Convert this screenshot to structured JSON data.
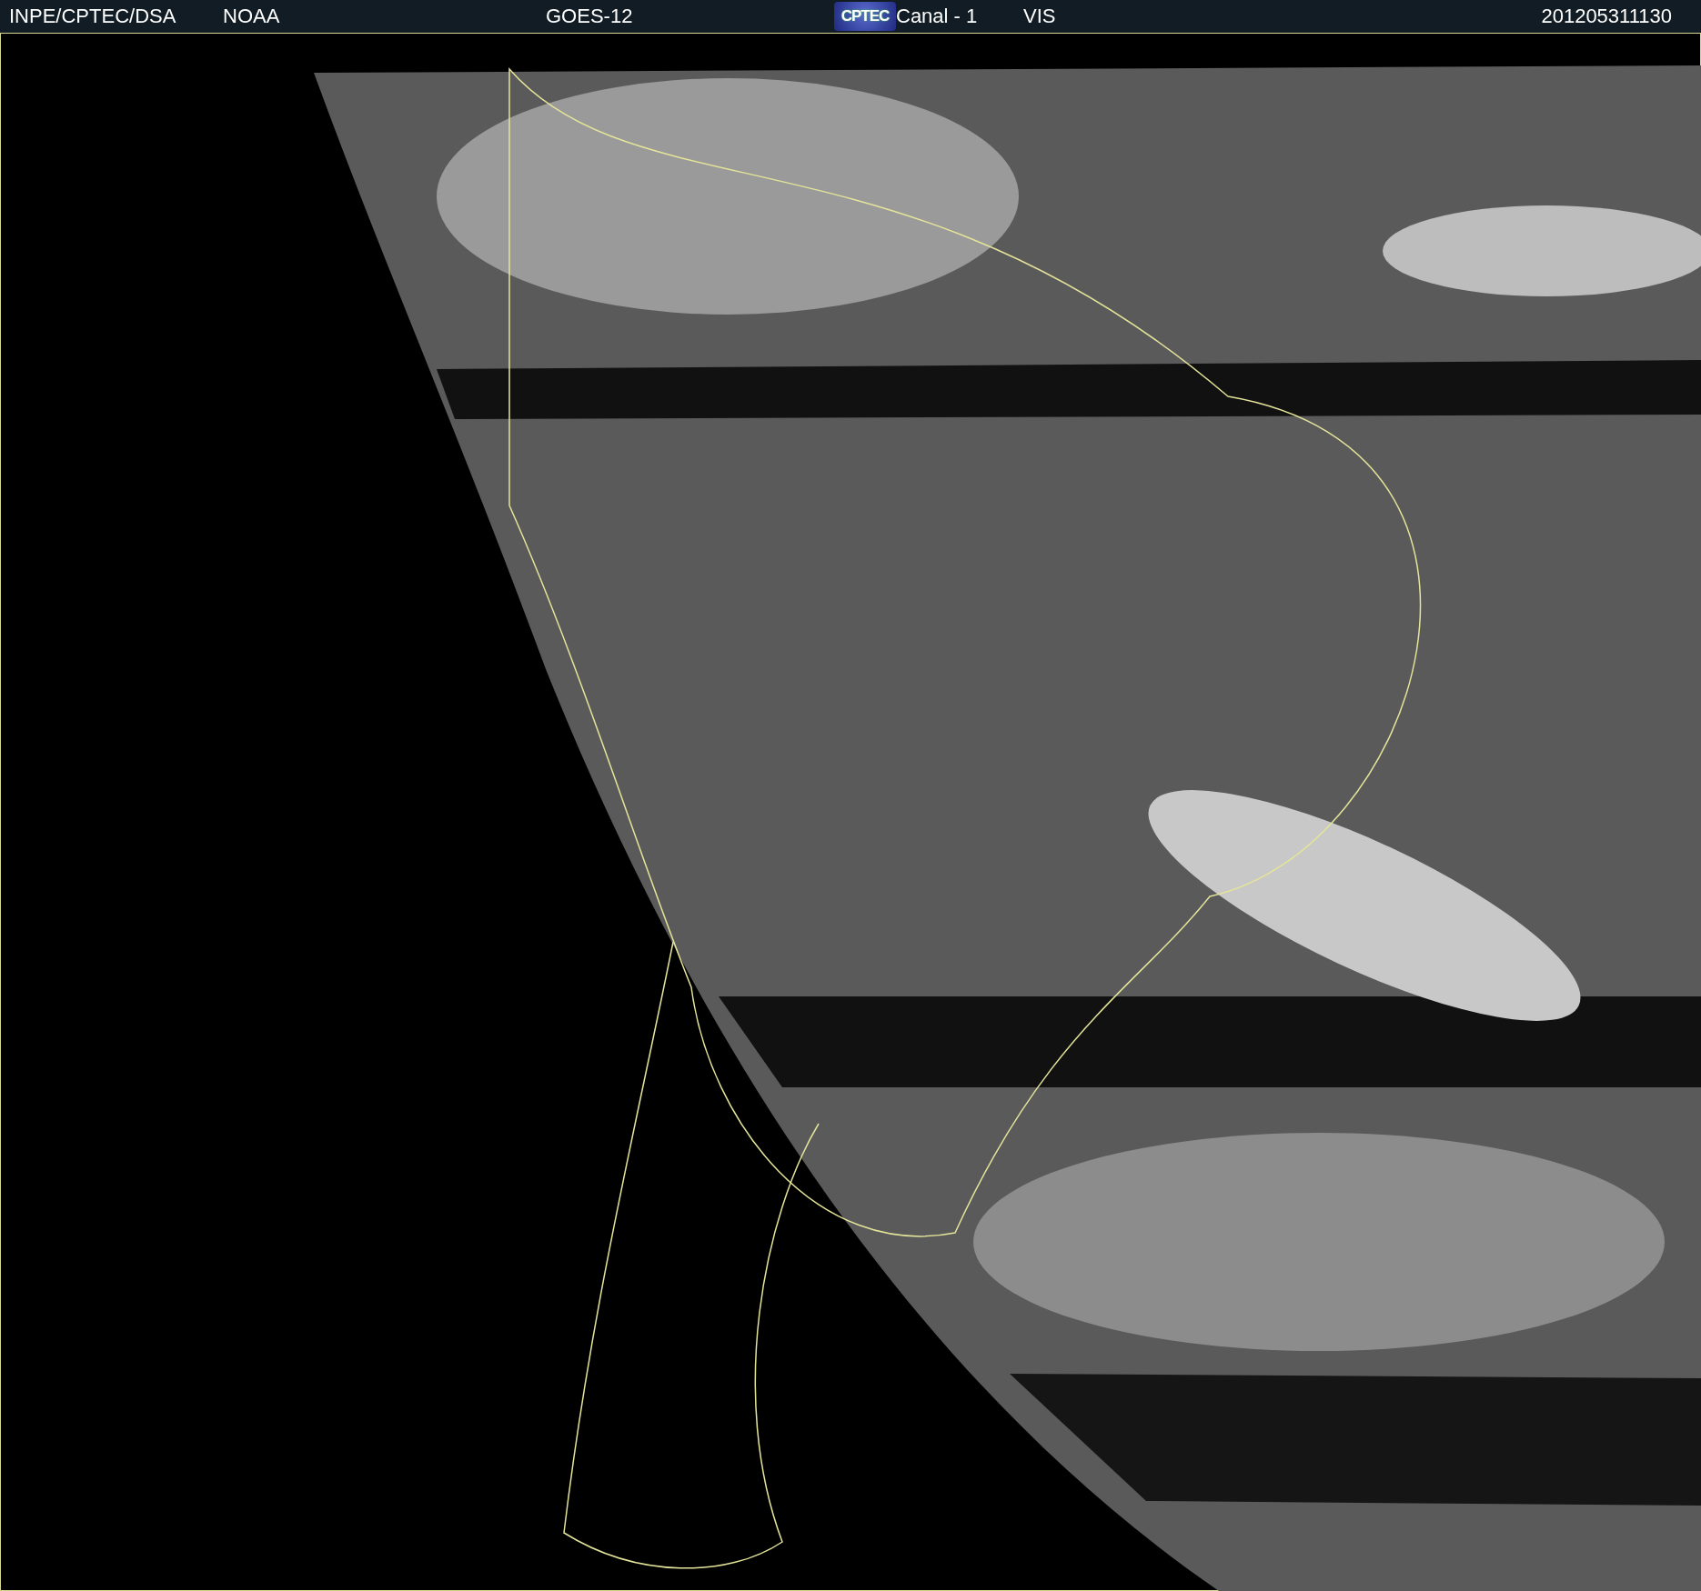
{
  "header": {
    "items": [
      {
        "kind": "text",
        "text": "INPE/CPTEC/DSA"
      },
      {
        "kind": "text",
        "text": "NOAA"
      },
      {
        "kind": "text",
        "text": "GOES-12"
      },
      {
        "kind": "logo",
        "text": "CPTEC"
      },
      {
        "kind": "text",
        "text": "Canal - 1"
      },
      {
        "kind": "text",
        "text": "VIS"
      },
      {
        "kind": "text",
        "text": "201205311130"
      }
    ]
  }
}
